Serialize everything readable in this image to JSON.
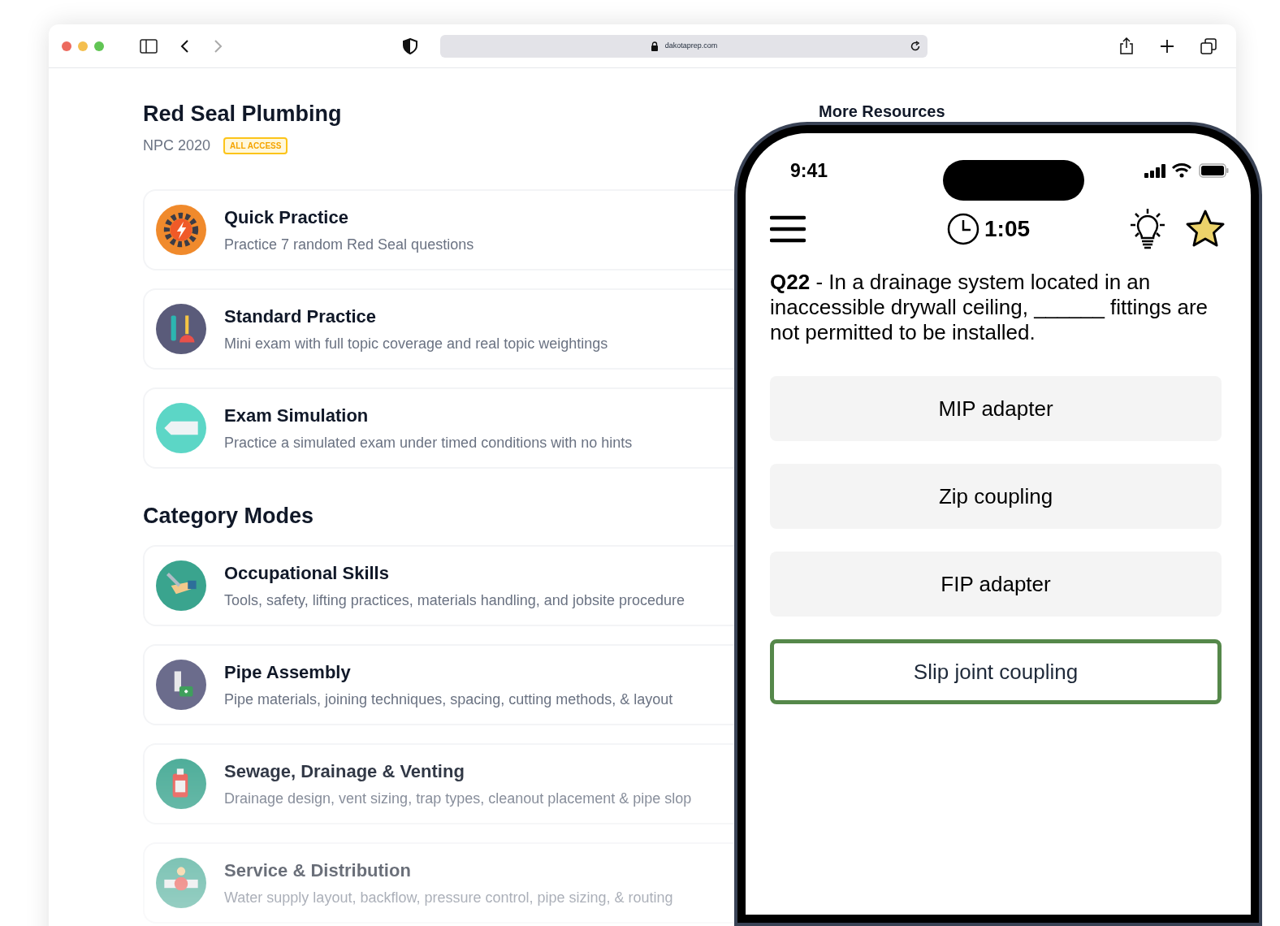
{
  "browser": {
    "url": "dakotaprep.com",
    "back_enabled": true,
    "forward_enabled": false
  },
  "page": {
    "title": "Red Seal Plumbing",
    "edition": "NPC 2020",
    "badge": "ALL ACCESS",
    "side_heading": "More Resources",
    "modes": [
      {
        "title": "Quick Practice",
        "description": "Practice 7 random Red Seal questions"
      },
      {
        "title": "Standard Practice",
        "description": "Mini exam with full topic coverage and real topic weightings"
      },
      {
        "title": "Exam Simulation",
        "description": "Practice a simulated exam under timed conditions with no hints"
      }
    ],
    "category_heading": "Category Modes",
    "categories": [
      {
        "title": "Occupational Skills",
        "description": "Tools, safety, lifting practices, materials handling, and jobsite procedure"
      },
      {
        "title": "Pipe Assembly",
        "description": "Pipe materials, joining techniques, spacing, cutting methods, & layout"
      },
      {
        "title": "Sewage, Drainage & Venting",
        "description": "Drainage design, vent sizing, trap types, cleanout placement & pipe slop"
      },
      {
        "title": "Service & Distribution",
        "description": "Water supply layout, backflow, pressure control, pipe sizing, & routing"
      }
    ]
  },
  "phone": {
    "time": "9:41",
    "timer": "1:05",
    "question": "**Q22** - In a drainage system located in an inaccessible drywall ceiling, ______ fittings are not permitted to be installed.",
    "answers": [
      {
        "label": "MIP adapter",
        "selected": false
      },
      {
        "label": "Zip coupling",
        "selected": false
      },
      {
        "label": "FIP adapter",
        "selected": false
      },
      {
        "label": "Slip joint coupling",
        "selected": true
      }
    ]
  }
}
